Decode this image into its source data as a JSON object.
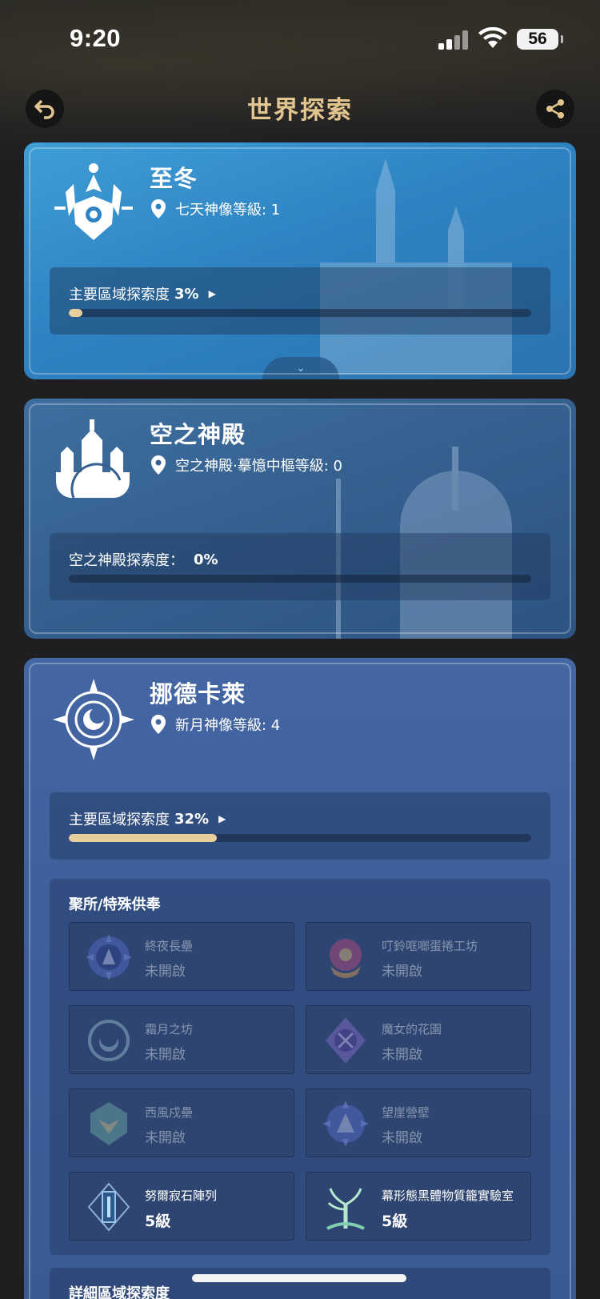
{
  "status_bar": {
    "time": "9:20",
    "battery": "56"
  },
  "header": {
    "title": "世界探索"
  },
  "regions": [
    {
      "name": "至冬",
      "sub_label": "七天神像等級: 1",
      "progress_label": "主要區域探索度",
      "progress_value": "3%",
      "progress_fraction": 0.03,
      "has_caret": true
    },
    {
      "name": "空之神殿",
      "sub_label": "空之神殿·摹憶中樞等級: 0",
      "progress_label": "空之神殿探索度：",
      "progress_value": "0%",
      "progress_fraction": 0.0,
      "has_caret": false
    },
    {
      "name": "挪德卡萊",
      "sub_label": "新月神像等級: 4",
      "progress_label": "主要區域探索度",
      "progress_value": "32%",
      "progress_fraction": 0.32,
      "has_caret": true,
      "offerings_title": "聚所/特殊供奉",
      "offerings": [
        {
          "name": "終夜長壘",
          "status": "未開啟",
          "icon": "night-fortress-icon"
        },
        {
          "name": "叮鈴哐啷蛋捲工坊",
          "status": "未開啟",
          "icon": "eggroll-workshop-icon"
        },
        {
          "name": "霜月之坊",
          "status": "未開啟",
          "icon": "frost-moon-icon"
        },
        {
          "name": "魔女的花園",
          "status": "未開啟",
          "icon": "witch-garden-icon"
        },
        {
          "name": "西風戍壘",
          "status": "未開啟",
          "icon": "west-wind-bastion-icon"
        },
        {
          "name": "望崖營壁",
          "status": "未開啟",
          "icon": "cliff-camp-icon"
        },
        {
          "name": "努爾寂石陣列",
          "status": "5級",
          "icon": "stone-array-icon"
        },
        {
          "name": "幕形態黑體物質籠實驗室",
          "status": "5級",
          "icon": "lab-tree-icon"
        }
      ],
      "detail_title": "詳細區域探索度"
    }
  ],
  "colors": {
    "accent_gold": "#e2c58f",
    "progress_fill": "#e6cf9d"
  }
}
